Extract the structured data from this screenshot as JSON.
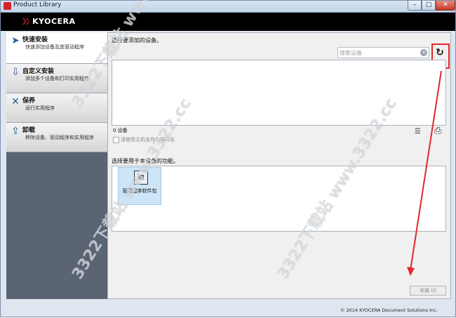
{
  "window": {
    "title": "Product Library",
    "minimize": "–",
    "maximize": "□",
    "close": "✕"
  },
  "brand": {
    "name": "KYOCERA",
    "color": "#d3202a"
  },
  "sidebar": {
    "items": [
      {
        "title": "快速安装",
        "desc": "快速添加设备及其驱动程序",
        "icon": "quick-install-icon"
      },
      {
        "title": "自定义安装",
        "desc": "添加多个设备和打印实用程序",
        "icon": "custom-install-icon"
      },
      {
        "title": "保养",
        "desc": "运行实用程序",
        "icon": "maintenance-icon"
      },
      {
        "title": "卸载",
        "desc": "移除设备、驱动程序和实用程序",
        "icon": "uninstall-icon"
      }
    ]
  },
  "main": {
    "select_device_label": "选择要添加的设备。",
    "search_placeholder": "搜索设备",
    "device_count": "0 设备",
    "host_name_checkbox": "请使用主机名作为端口名",
    "select_function_label": "选择要用于本设备的功能。",
    "function_tiles": [
      {
        "label": "驱动程序软件包",
        "icon": "driver-package-icon"
      }
    ],
    "install_label": "安装 (I)"
  },
  "footer": {
    "copyright": "© 2014 KYOCERA Document Solutions Inc."
  },
  "watermark": "3322下载站 www.3322.cc",
  "accent_color": "#e3262a"
}
